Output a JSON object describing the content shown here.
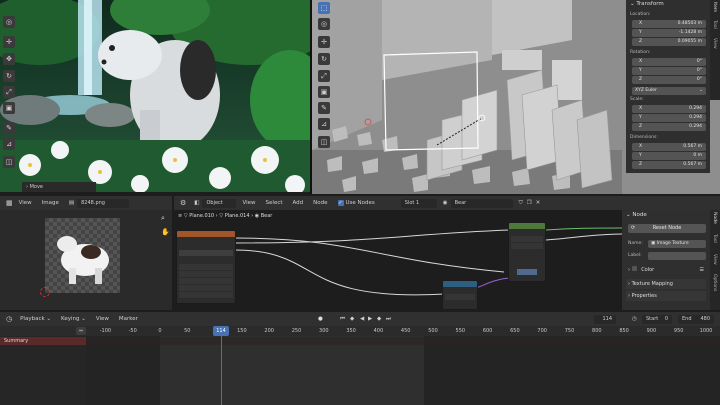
{
  "viewport_left": {
    "status_label": "Move"
  },
  "viewport_right": {
    "transform": {
      "title": "Transform",
      "location_label": "Location:",
      "location": [
        {
          "axis": "X",
          "value": "0.48503 m"
        },
        {
          "axis": "Y",
          "value": "-1.1428 m"
        },
        {
          "axis": "Z",
          "value": "0.09055 m"
        }
      ],
      "rotation_label": "Rotation:",
      "rotation": [
        {
          "axis": "X",
          "value": "0°"
        },
        {
          "axis": "Y",
          "value": "0°"
        },
        {
          "axis": "Z",
          "value": "0°"
        }
      ],
      "rotation_mode": "XYZ Euler",
      "scale_label": "Scale:",
      "scale": [
        {
          "axis": "X",
          "value": "0.294"
        },
        {
          "axis": "Y",
          "value": "0.294"
        },
        {
          "axis": "Z",
          "value": "0.294"
        }
      ],
      "dimensions_label": "Dimensions:",
      "dimensions": [
        {
          "axis": "X",
          "value": "0.567 m"
        },
        {
          "axis": "Y",
          "value": "0 m"
        },
        {
          "axis": "Z",
          "value": "0.567 m"
        }
      ]
    },
    "side_tabs": [
      "Item",
      "Tool",
      "View"
    ]
  },
  "image_editor": {
    "menu": [
      "View",
      "Image"
    ],
    "image_name": "8248.png"
  },
  "node_editor": {
    "mode": "Object",
    "menu": [
      "View",
      "Select",
      "Add",
      "Node"
    ],
    "use_nodes_label": "Use Nodes",
    "slot": "Slot 1",
    "material": "Bear",
    "breadcrumb": [
      "Plane.010",
      "Plane.014",
      "Bear"
    ]
  },
  "node_panel": {
    "title": "Node",
    "reset_label": "Reset Node",
    "name_label": "Name:",
    "name_value": "Image Texture",
    "label_label": "Label:",
    "label_value": "",
    "color_label": "Color",
    "texture_mapping": "Texture Mapping",
    "properties": "Properties",
    "side_tabs": [
      "Node",
      "Tool",
      "View",
      "Options"
    ]
  },
  "timeline": {
    "menu": [
      "Playback",
      "Keying",
      "View",
      "Marker"
    ],
    "current_frame": "114",
    "start_label": "Start",
    "start_value": "0",
    "end_label": "End",
    "end_value": "480",
    "summary_label": "Summary",
    "ruler": [
      "-100",
      "-50",
      "0",
      "50",
      "114",
      "150",
      "200",
      "250",
      "300",
      "350",
      "400",
      "450",
      "500",
      "550",
      "600",
      "650",
      "700",
      "750",
      "800",
      "850",
      "900",
      "950",
      "1000"
    ]
  },
  "colors": {
    "accent": "#4772b3",
    "node_image_header": "#e07b28",
    "node_bsdf_header": "#4d7a3b",
    "node_vector_header": "#3a6a8e",
    "summary_bar": "#5a2a2a"
  }
}
